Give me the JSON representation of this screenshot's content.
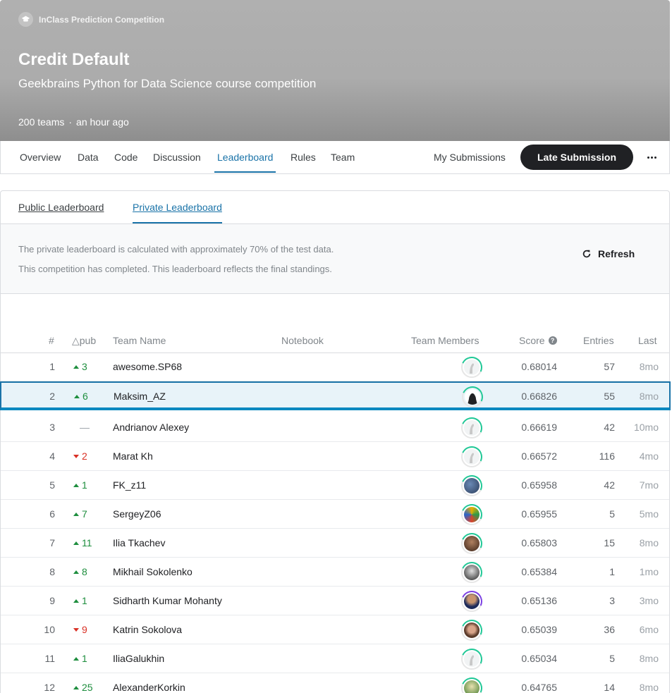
{
  "header": {
    "competition_type": "InClass Prediction Competition",
    "title": "Credit Default",
    "subtitle": "Geekbrains Python for Data Science course competition",
    "teams": "200 teams",
    "separator": "·",
    "updated": "an hour ago"
  },
  "nav": {
    "tabs": [
      {
        "label": "Overview"
      },
      {
        "label": "Data"
      },
      {
        "label": "Code"
      },
      {
        "label": "Discussion"
      },
      {
        "label": "Leaderboard",
        "active": true
      },
      {
        "label": "Rules"
      },
      {
        "label": "Team"
      }
    ],
    "my_submissions": "My Submissions",
    "late_submission": "Late Submission"
  },
  "leaderboard": {
    "tabs": {
      "public": "Public Leaderboard",
      "private": "Private Leaderboard"
    },
    "active_tab": "Private Leaderboard",
    "info_line1": "The private leaderboard is calculated with approximately 70% of the test data.",
    "info_line2": "This competition has completed. This leaderboard reflects the final standings.",
    "refresh_label": "Refresh",
    "columns": {
      "rank": "#",
      "delta": "△pub",
      "team": "Team Name",
      "notebook": "Notebook",
      "members": "Team Members",
      "score": "Score",
      "entries": "Entries",
      "last": "Last"
    },
    "rows": [
      {
        "rank": "1",
        "dir": "up",
        "delta": "3",
        "team": "awesome.SP68",
        "score": "0.68014",
        "entries": "57",
        "last": "8mo",
        "avatar": "default",
        "ring": "#20beff"
      },
      {
        "rank": "2",
        "dir": "up",
        "delta": "6",
        "team": "Maksim_AZ",
        "score": "0.66826",
        "entries": "55",
        "last": "8mo",
        "avatar": "dark",
        "ring": "#20beff",
        "highlight": true
      },
      {
        "rank": "3",
        "dir": "none",
        "delta": "—",
        "team": "Andrianov Alexey",
        "score": "0.66619",
        "entries": "42",
        "last": "10mo",
        "avatar": "default",
        "ring": "#20beff"
      },
      {
        "rank": "4",
        "dir": "down",
        "delta": "2",
        "team": "Marat Kh",
        "score": "0.66572",
        "entries": "116",
        "last": "4mo",
        "avatar": "default",
        "ring": "#20beff"
      },
      {
        "rank": "5",
        "dir": "up",
        "delta": "1",
        "team": "FK_z11",
        "score": "0.65958",
        "entries": "42",
        "last": "7mo",
        "avatar": "photo-blue",
        "ring": "#20beff"
      },
      {
        "rank": "6",
        "dir": "up",
        "delta": "7",
        "team": "SergeyZ06",
        "score": "0.65955",
        "entries": "5",
        "last": "5mo",
        "avatar": "photo-color",
        "ring": "#20beff"
      },
      {
        "rank": "7",
        "dir": "up",
        "delta": "11",
        "team": "Ilia Tkachev",
        "score": "0.65803",
        "entries": "15",
        "last": "8mo",
        "avatar": "photo-brown",
        "ring": "#20beff"
      },
      {
        "rank": "8",
        "dir": "up",
        "delta": "8",
        "team": "Mikhail Sokolenko",
        "score": "0.65384",
        "entries": "1",
        "last": "1mo",
        "avatar": "photo-bw",
        "ring": "#20beff"
      },
      {
        "rank": "9",
        "dir": "up",
        "delta": "1",
        "team": "Sidharth Kumar Mohanty",
        "score": "0.65136",
        "entries": "3",
        "last": "3mo",
        "avatar": "photo-man",
        "ring": "#7b3fe4"
      },
      {
        "rank": "10",
        "dir": "down",
        "delta": "9",
        "team": "Katrin Sokolova",
        "score": "0.65039",
        "entries": "36",
        "last": "6mo",
        "avatar": "photo-woman",
        "ring": "#20beff"
      },
      {
        "rank": "11",
        "dir": "up",
        "delta": "1",
        "team": "IliaGalukhin",
        "score": "0.65034",
        "entries": "5",
        "last": "8mo",
        "avatar": "default",
        "ring": "#20beff"
      },
      {
        "rank": "12",
        "dir": "up",
        "delta": "25",
        "team": "AlexanderKorkin",
        "score": "0.64765",
        "entries": "14",
        "last": "8mo",
        "avatar": "photo-bird",
        "ring": "#20beff"
      }
    ]
  },
  "colors": {
    "accent": "#1a73a8",
    "up": "#1e8e3e",
    "down": "#d93025",
    "ring_green": "#20c997"
  }
}
